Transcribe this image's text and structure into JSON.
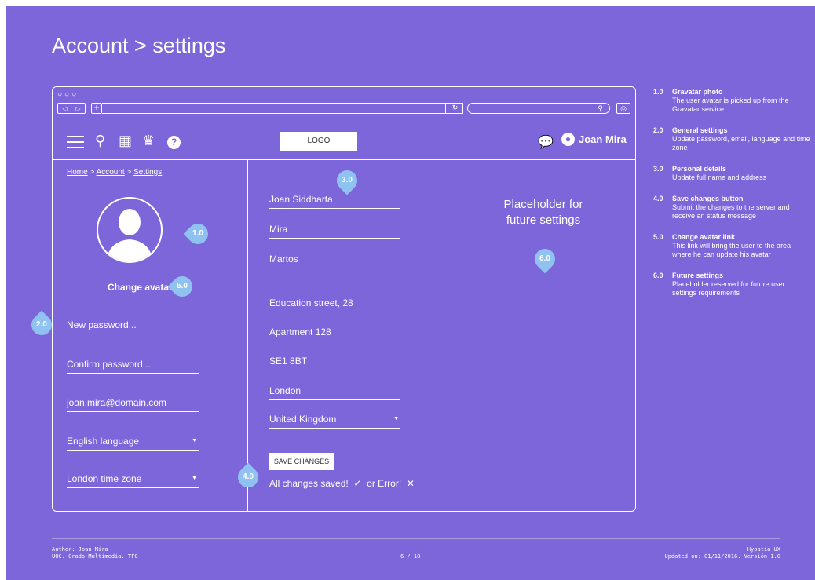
{
  "title": "Account > settings",
  "browser": {
    "dots": "○○○"
  },
  "toolbar": {
    "logo": "LOGO",
    "user_name": "Joan Mira"
  },
  "breadcrumb": [
    "Home",
    "Account",
    "Settings"
  ],
  "breadcrumb_sep": ">",
  "left": {
    "change_avatar": "Change avatar",
    "fields": [
      "New password...",
      "Confirm password...",
      "joan.mira@domain.com"
    ],
    "language": "English language",
    "timezone": "London time zone"
  },
  "middle": {
    "fields": [
      "Joan Siddharta",
      "Mira",
      "Martos",
      "Education street, 28",
      "Apartment 128",
      "SE1 8BT",
      "London"
    ],
    "country": "United Kingdom",
    "save_button": "SAVE CHANGES",
    "status_ok": "All changes saved!",
    "status_err": "or Error!"
  },
  "right": {
    "placeholder": "Placeholder for future settings"
  },
  "markers": {
    "m1": "1.0",
    "m2": "2.0",
    "m3": "3.0",
    "m4": "4.0",
    "m5": "5.0",
    "m6": "6.0"
  },
  "notes": [
    {
      "num": "1.0",
      "title": "Gravatar photo",
      "desc": "The user avatar is picked up from the Gravatar service"
    },
    {
      "num": "2.0",
      "title": "General settings",
      "desc": "Update password, email, language and time zone"
    },
    {
      "num": "3.0",
      "title": "Personal details",
      "desc": "Update full name and address"
    },
    {
      "num": "4.0",
      "title": "Save changes button",
      "desc": "Submit the changes to the server and receive an status message"
    },
    {
      "num": "5.0",
      "title": "Change avatar link",
      "desc": "This link will bring the user to the area where he can update his avatar"
    },
    {
      "num": "6.0",
      "title": "Future settings",
      "desc": "Placeholder reserved for future user settings requirements"
    }
  ],
  "footer": {
    "author": "Author: Joan Mira",
    "course": "UOC. Grado Multimedia. TFG",
    "page": "6 / 18",
    "brand": "Hypatia UX",
    "updated": "Updated on: 01/11/2016. Versión 1.0"
  },
  "colors": {
    "background": "#7c66d9",
    "marker": "#8fc2f0",
    "foreground": "#ffffff"
  }
}
